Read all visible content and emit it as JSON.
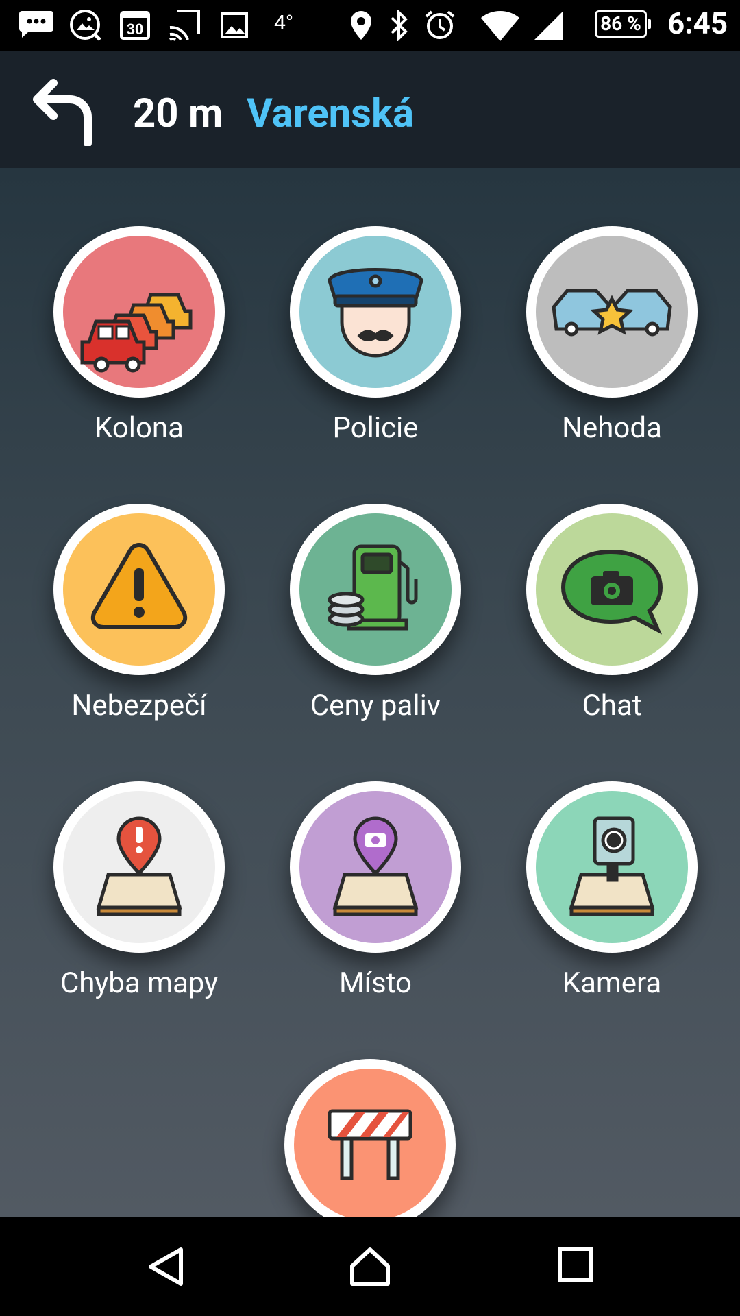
{
  "status_bar": {
    "temperature": "4°",
    "battery": "86 %",
    "time": "6:45"
  },
  "navigation": {
    "distance": "20 m",
    "street": "Varenská",
    "turn_icon": "turn-left-icon"
  },
  "reports": [
    {
      "label": "Kolona",
      "icon": "traffic-jam-icon",
      "color": "#e8787c"
    },
    {
      "label": "Policie",
      "icon": "police-icon",
      "color": "#8ccad3"
    },
    {
      "label": "Nehoda",
      "icon": "accident-icon",
      "color": "#bdbdbd"
    },
    {
      "label": "Nebezpečí",
      "icon": "hazard-icon",
      "color": "#fcc15a"
    },
    {
      "label": "Ceny paliv",
      "icon": "fuel-price-icon",
      "color": "#6db393"
    },
    {
      "label": "Chat",
      "icon": "chat-camera-icon",
      "color": "#bcd89a"
    },
    {
      "label": "Chyba mapy",
      "icon": "map-error-icon",
      "color": "#eeeeee"
    },
    {
      "label": "Místo",
      "icon": "place-icon",
      "color": "#c19ed3"
    },
    {
      "label": "Kamera",
      "icon": "speed-camera-icon",
      "color": "#8cd6b8"
    },
    {
      "label": "",
      "icon": "road-closure-icon",
      "color": "#fb9373"
    }
  ],
  "system_nav": {
    "back": "back-icon",
    "home": "home-icon",
    "recents": "recents-icon"
  }
}
